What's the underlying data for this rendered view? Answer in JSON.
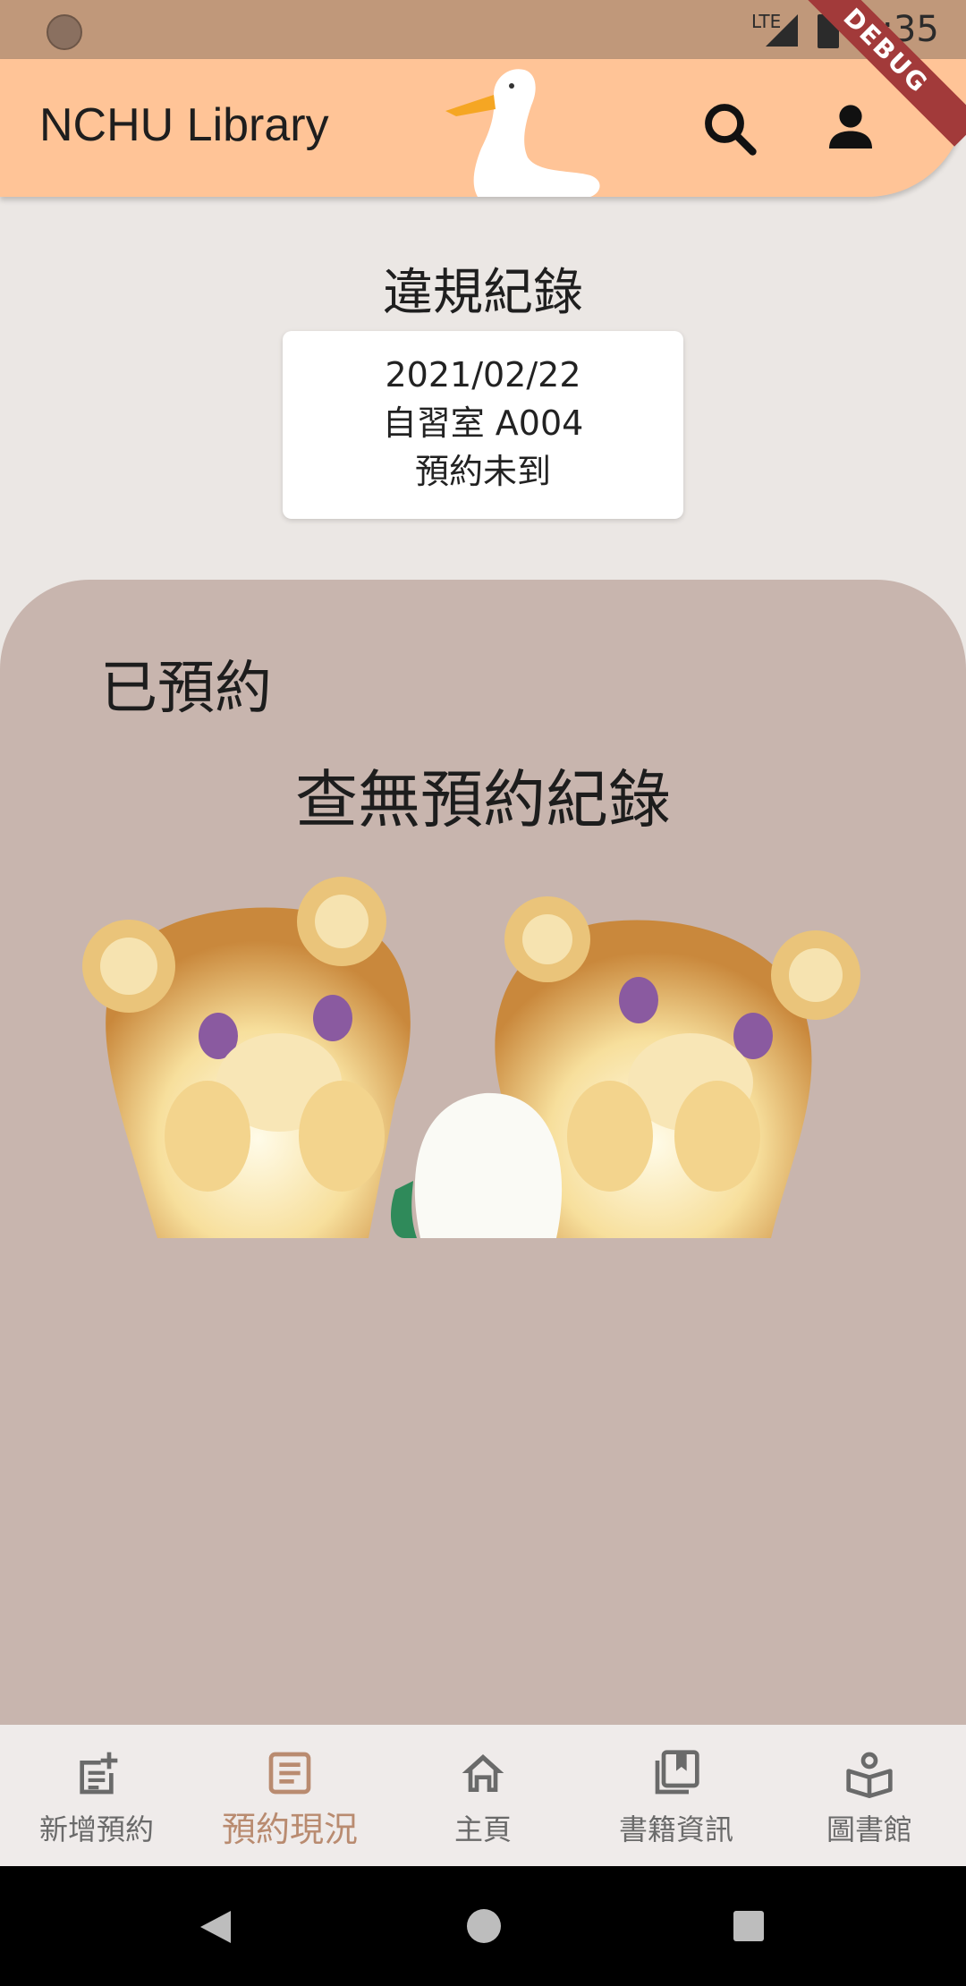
{
  "status_bar": {
    "network": "LTE",
    "time": "4:35"
  },
  "app_bar": {
    "title": "NCHU Library",
    "debug_banner": "DEBUG",
    "accent_color": "#ffc497"
  },
  "violations": {
    "title": "違規紀錄",
    "record": {
      "date": "2021/02/22",
      "room": "自習室 A004",
      "status": "預約未到"
    }
  },
  "reserved": {
    "heading": "已預約",
    "empty_message": "查無預約紀錄"
  },
  "bottom_nav": {
    "items": [
      {
        "label": "新增預約",
        "icon": "add-reservation-icon"
      },
      {
        "label": "預約現況",
        "icon": "reservation-status-icon",
        "active": true
      },
      {
        "label": "主頁",
        "icon": "home-icon"
      },
      {
        "label": "書籍資訊",
        "icon": "book-info-icon"
      },
      {
        "label": "圖書館",
        "icon": "library-icon"
      }
    ],
    "active_color": "#b98b70"
  }
}
